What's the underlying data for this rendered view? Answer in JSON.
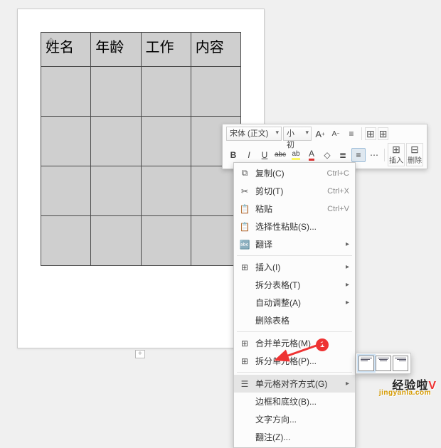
{
  "table": {
    "headers": [
      "姓名",
      "年龄",
      "工作",
      "内容"
    ],
    "rows": 5,
    "cols": 4
  },
  "toolbar": {
    "font_family": "宋体 (正文)",
    "font_size": "小初",
    "grow_font": "A",
    "shrink_font": "A",
    "bold": "B",
    "italic": "I",
    "underline": "U",
    "strike": "abc",
    "highlight": "ab",
    "font_color": "A",
    "insert_label": "插入",
    "delete_label": "删除"
  },
  "menu": {
    "copy": {
      "icon": "⧉",
      "label": "复制(C)",
      "shortcut": "Ctrl+C"
    },
    "cut": {
      "icon": "✂",
      "label": "剪切(T)",
      "shortcut": "Ctrl+X"
    },
    "paste": {
      "icon": "📋",
      "label": "粘贴",
      "shortcut": "Ctrl+V"
    },
    "paste_special": {
      "icon": "📋",
      "label": "选择性粘贴(S)..."
    },
    "translate": {
      "icon": "🔤",
      "label": "翻译"
    },
    "insert": {
      "icon": "⊞",
      "label": "插入(I)"
    },
    "split_table": {
      "icon": "",
      "label": "拆分表格(T)"
    },
    "auto_fit": {
      "icon": "",
      "label": "自动调整(A)"
    },
    "delete_table": {
      "icon": "",
      "label": "删除表格"
    },
    "merge_cells": {
      "icon": "⊞",
      "label": "合并单元格(M)"
    },
    "split_cells": {
      "icon": "⊞",
      "label": "拆分单元格(P)..."
    },
    "cell_align": {
      "icon": "☰",
      "label": "单元格对齐方式(G)"
    },
    "borders": {
      "icon": "",
      "label": "边框和底纹(B)..."
    },
    "text_direction": {
      "icon": "",
      "label": "文字方向..."
    },
    "props": {
      "icon": "",
      "label": "翻注(Z)..."
    }
  },
  "annotation": {
    "step": "1"
  },
  "watermark": {
    "brand": "经验啦",
    "suffix": "V",
    "url": "jingyanla.com"
  }
}
